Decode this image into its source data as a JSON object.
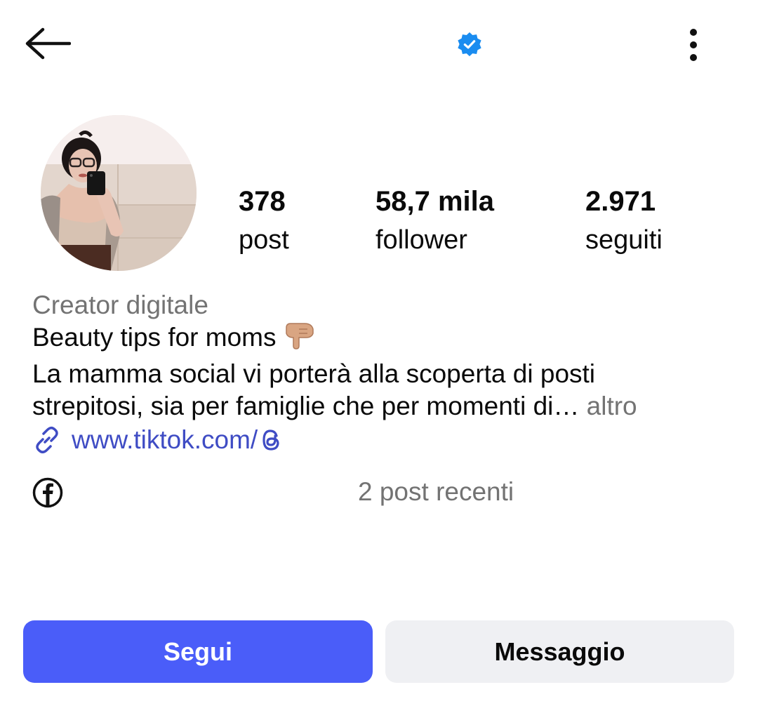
{
  "header": {
    "back_icon": "arrow-left-icon",
    "verified_icon": "verified-badge-icon",
    "more_icon": "vertical-dots-icon"
  },
  "profile": {
    "avatar_icon": "profile-photo",
    "stats": [
      {
        "value": "378",
        "label": "post"
      },
      {
        "value": "58,7 mila",
        "label": "follower"
      },
      {
        "value": "2.971",
        "label": "seguiti"
      }
    ]
  },
  "bio": {
    "category": "Creator digitale",
    "line1": "Beauty tips for moms",
    "line1_emoji": "👇",
    "line2": "La mamma social vi porterà alla scoperta di posti",
    "line3": "strepitosi, sia per famiglie che per momenti di…",
    "more_label": "altro",
    "link_text": "www.tiktok.com/",
    "link_icon": "link-icon",
    "threads_icon": "threads-icon"
  },
  "social": {
    "facebook_icon": "facebook-icon",
    "recent_posts": "2 post recenti"
  },
  "actions": {
    "follow_label": "Segui",
    "message_label": "Messaggio"
  },
  "colors": {
    "accent": "#4a5df9",
    "link": "#3f4cc4",
    "verified": "#1a8cf0",
    "muted": "#737373",
    "secondary_button": "#eff0f3"
  }
}
